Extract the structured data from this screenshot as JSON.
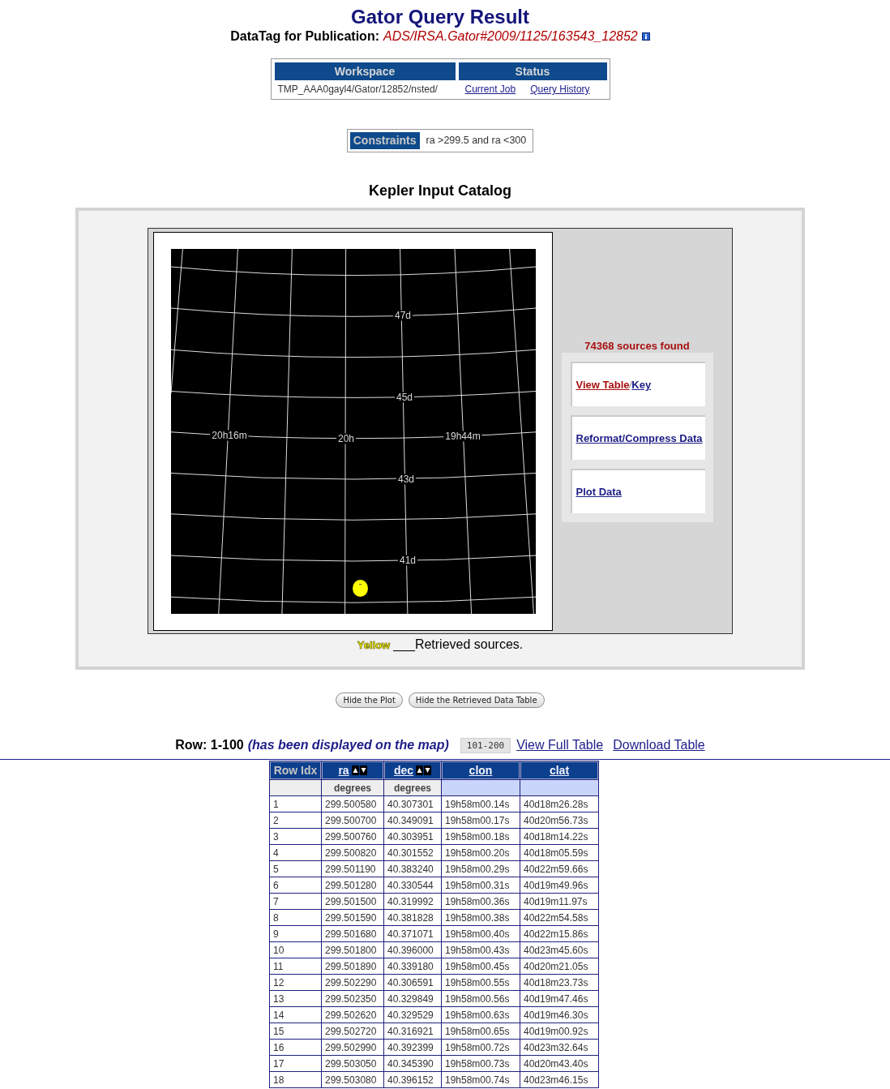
{
  "header": {
    "title": "Gator Query Result",
    "datatag_label": "DataTag for Publication:",
    "datatag": "ADS/IRSA.Gator#2009/1125/163543_12852"
  },
  "workspace": {
    "columns": [
      "Workspace",
      "Status"
    ],
    "path": "TMP_AAA0gayl4/Gator/12852/nsted/",
    "links": [
      "Current Job",
      "Query History"
    ]
  },
  "constraints": {
    "label": "Constraints",
    "value": "ra >299.5 and ra <300"
  },
  "catalog_title": "Kepler Input Catalog",
  "sky_map": {
    "dec_labels": [
      "47d",
      "45d",
      "43d",
      "41d"
    ],
    "ra_labels": [
      "20h16m",
      "20h",
      "19h44m"
    ]
  },
  "legend": [
    {
      "label": "Yellow",
      "text": "___Retrieved sources.",
      "color": "#ffff00"
    }
  ],
  "side_panel": {
    "count": "74368 sources found",
    "cards": [
      {
        "links": [
          {
            "text": "View Table",
            "visited": true
          },
          {
            "text": "Key",
            "visited": false
          }
        ],
        "separator": "/"
      },
      {
        "links": [
          {
            "text": "Reformat/Compress Data",
            "visited": false
          }
        ]
      },
      {
        "links": [
          {
            "text": "Plot Data",
            "visited": false
          }
        ]
      }
    ]
  },
  "buttons": [
    "Hide the Plot",
    "Hide the Retrieved Data Table"
  ],
  "results_bar": {
    "rows": "Row: 1-100",
    "note": "(has been displayed on the map)",
    "next_page": "101-200",
    "links": [
      "View Full Table",
      "Download Table"
    ]
  },
  "table": {
    "columns": [
      {
        "label": "Row Idx",
        "kind": "index"
      },
      {
        "label": "ra",
        "kind": "sortable",
        "unit": "degrees"
      },
      {
        "label": "dec",
        "kind": "sortable",
        "unit": "degrees"
      },
      {
        "label": "clon",
        "kind": "derived"
      },
      {
        "label": "clat",
        "kind": "derived"
      }
    ],
    "rows": [
      [
        "1",
        "299.500580",
        "40.307301",
        "19h58m00.14s",
        "40d18m26.28s"
      ],
      [
        "2",
        "299.500700",
        "40.349091",
        "19h58m00.17s",
        "40d20m56.73s"
      ],
      [
        "3",
        "299.500760",
        "40.303951",
        "19h58m00.18s",
        "40d18m14.22s"
      ],
      [
        "4",
        "299.500820",
        "40.301552",
        "19h58m00.20s",
        "40d18m05.59s"
      ],
      [
        "5",
        "299.501190",
        "40.383240",
        "19h58m00.29s",
        "40d22m59.66s"
      ],
      [
        "6",
        "299.501280",
        "40.330544",
        "19h58m00.31s",
        "40d19m49.96s"
      ],
      [
        "7",
        "299.501500",
        "40.319992",
        "19h58m00.36s",
        "40d19m11.97s"
      ],
      [
        "8",
        "299.501590",
        "40.381828",
        "19h58m00.38s",
        "40d22m54.58s"
      ],
      [
        "9",
        "299.501680",
        "40.371071",
        "19h58m00.40s",
        "40d22m15.86s"
      ],
      [
        "10",
        "299.501800",
        "40.396000",
        "19h58m00.43s",
        "40d23m45.60s"
      ],
      [
        "11",
        "299.501890",
        "40.339180",
        "19h58m00.45s",
        "40d20m21.05s"
      ],
      [
        "12",
        "299.502290",
        "40.306591",
        "19h58m00.55s",
        "40d18m23.73s"
      ],
      [
        "13",
        "299.502350",
        "40.329849",
        "19h58m00.56s",
        "40d19m47.46s"
      ],
      [
        "14",
        "299.502620",
        "40.329529",
        "19h58m00.63s",
        "40d19m46.30s"
      ],
      [
        "15",
        "299.502720",
        "40.316921",
        "19h58m00.65s",
        "40d19m00.92s"
      ],
      [
        "16",
        "299.502990",
        "40.392399",
        "19h58m00.72s",
        "40d23m32.64s"
      ],
      [
        "17",
        "299.503050",
        "40.345390",
        "19h58m00.73s",
        "40d20m43.40s"
      ],
      [
        "18",
        "299.503080",
        "40.396152",
        "19h58m00.74s",
        "40d23m46.15s"
      ]
    ]
  }
}
